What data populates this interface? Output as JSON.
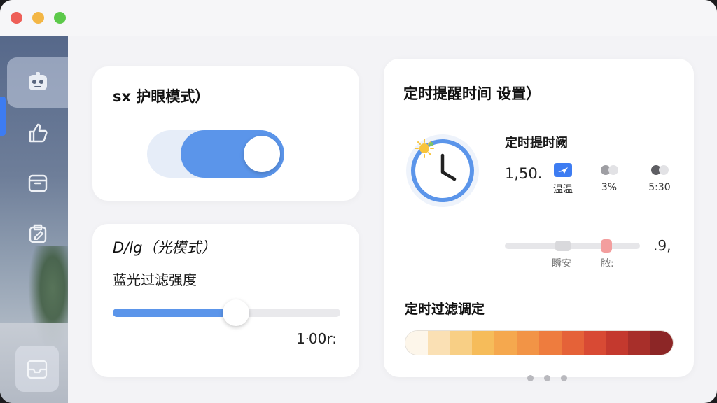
{
  "window": {
    "traffic_lights": {
      "close": "#ee5f58",
      "minimize": "#f3b645",
      "zoom": "#5cc94a"
    }
  },
  "sidebar": {
    "items": [
      {
        "icon": "robot-face-icon",
        "active": true
      },
      {
        "icon": "thumbs-up-icon",
        "active": false
      },
      {
        "icon": "archive-box-icon",
        "active": false
      },
      {
        "icon": "clipboard-edit-icon",
        "active": false
      }
    ],
    "accent_color": "#3d7cf2"
  },
  "eye_card": {
    "title": "sx 护眼模式）",
    "toggle_on": true,
    "toggle_color": "#5b95ea"
  },
  "blue_card": {
    "title": "D/lg（光模式）",
    "slider_label": "蓝光过滤强度",
    "slider_value_fraction": 0.54,
    "slider_readout": "1ᐧ00r:"
  },
  "timer_card": {
    "title": "定时提醒时间 设置）",
    "clock_icon": "clock-with-sun-icon",
    "sub_title": "定时提时阙",
    "big_number": "1,50.",
    "options": [
      {
        "icon": "airplane-badge-icon",
        "label": "温温"
      },
      {
        "icon": "toggle-dots-icon",
        "label": "3%"
      },
      {
        "icon": "toggle-dots-dark-icon",
        "label": "5:30"
      }
    ],
    "mini_slider": {
      "labels": [
        "瞬安",
        "脓:"
      ],
      "value_text": ".9,",
      "thumb_color": "#f39e9e"
    },
    "filter_title": "定时过滤调定",
    "filter_colors": [
      "#fdf6ea",
      "#fae0b4",
      "#f8cf85",
      "#f6bc5a",
      "#f5a84e",
      "#f29446",
      "#ee7c3e",
      "#e56238",
      "#d84a34",
      "#c4392e",
      "#a82f2a",
      "#8c2626"
    ],
    "pager_count": 3
  }
}
